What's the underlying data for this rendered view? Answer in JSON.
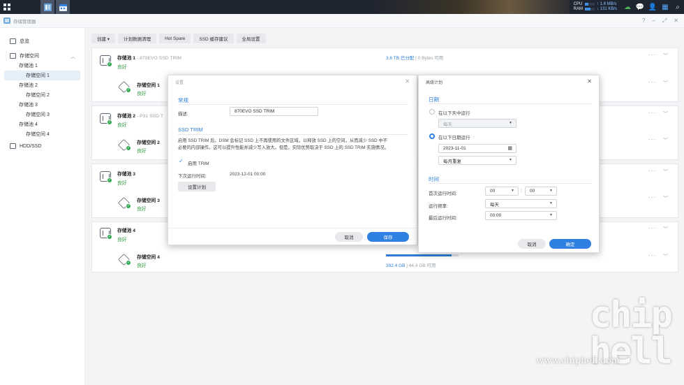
{
  "taskbar": {
    "icons": [
      "grid-icon",
      "storage-manager-icon",
      "calendar-icon"
    ],
    "cpu_label": "CPU",
    "ram_label": "RAM",
    "upload": "↑ 1.8 MB/s",
    "download": "↓ 131 KB/s",
    "cpu_level": 0.35,
    "ram_level": 0.55
  },
  "app": {
    "title": "存储管理器",
    "help": "?",
    "minimize": "–",
    "maximize": "⤢",
    "close": "✕"
  },
  "sidebar": {
    "overview": "总览",
    "storage": "存储空间",
    "items": [
      {
        "label": "存储池 1",
        "level": 2
      },
      {
        "label": "存储空间 1",
        "level": 3,
        "selected": true
      },
      {
        "label": "存储池 2",
        "level": 2
      },
      {
        "label": "存储空间 2",
        "level": 3
      },
      {
        "label": "存储池 3",
        "level": 2
      },
      {
        "label": "存储空间 3",
        "level": 3
      },
      {
        "label": "存储池 4",
        "level": 2
      },
      {
        "label": "存储空间 4",
        "level": 3
      }
    ],
    "hdd": "HDD/SSD"
  },
  "toolbar": {
    "create": "创建 ▾",
    "scheduled_scrub": "计划数据清理",
    "hot_spare": "Hot Spare",
    "ssd_cache": "SSD 缓存建议",
    "global_settings": "全局设置"
  },
  "pools": [
    {
      "name": "存储池 1",
      "sub": " - 870EVO SSD TRIM",
      "status": "良好",
      "used": "3.6 TB 已分配",
      "free": " | 0 Bytes 可用",
      "volume": "存储空间 1",
      "vstatus": "良好"
    },
    {
      "name": "存储池 2",
      "sub": " - P31 SSD T",
      "status": "良好",
      "volume": "存储空间 2",
      "vstatus": "良好"
    },
    {
      "name": "存储池 3",
      "sub": "",
      "status": "良好",
      "volume": "存储空间 3",
      "vstatus": "良好"
    },
    {
      "name": "存储池 4",
      "sub": "",
      "status": "良好",
      "volume": "存储空间 4",
      "vstatus": "良好",
      "vused": "392.4 GB",
      "vfree": " | 44.4 GB 可用",
      "vfill": 0.9
    }
  ],
  "settings_dialog": {
    "title": "设置",
    "general": "常规",
    "desc_label": "描述:",
    "desc_value": "870EVO SSD TRIM",
    "trim_title": "SSD TRIM",
    "trim_desc_1": "启用 SSD TRIM 后，DSM 会标记 SSD 上不再使用的文件区域，以释放 SSD 上的空间，从而减少 SSD 中不",
    "trim_desc_2": "必要的内部操作。这可以提升性能并减少写入放大。但是，实际优势取决于 SSD 上的 SSD TRIM 实施情况。",
    "enable_trim": "启用 TRIM",
    "next_run_label": "下次运行时间:",
    "next_run_value": "2023-12-01 00:00",
    "set_schedule": "设置计划",
    "cancel": "取消",
    "save": "保存"
  },
  "schedule_dialog": {
    "title": "高级计划",
    "date_title": "日期",
    "run_days": "在以下天中运行",
    "days_value": "每天",
    "run_date": "在以下日期运行",
    "date_value": "2023-11-01",
    "repeat_value": "每月重复",
    "time_title": "时间",
    "first_run_label": "首次运行时间:",
    "hour": "00",
    "minute": "00",
    "colon": ":",
    "freq_label": "运行频率:",
    "freq_value": "每天",
    "last_run_label": "最后运行时间:",
    "last_run_value": "00:00",
    "cancel": "取消",
    "ok": "确定"
  },
  "watermark": {
    "big": "chip\nhell",
    "url": "www.chiphell.com"
  }
}
